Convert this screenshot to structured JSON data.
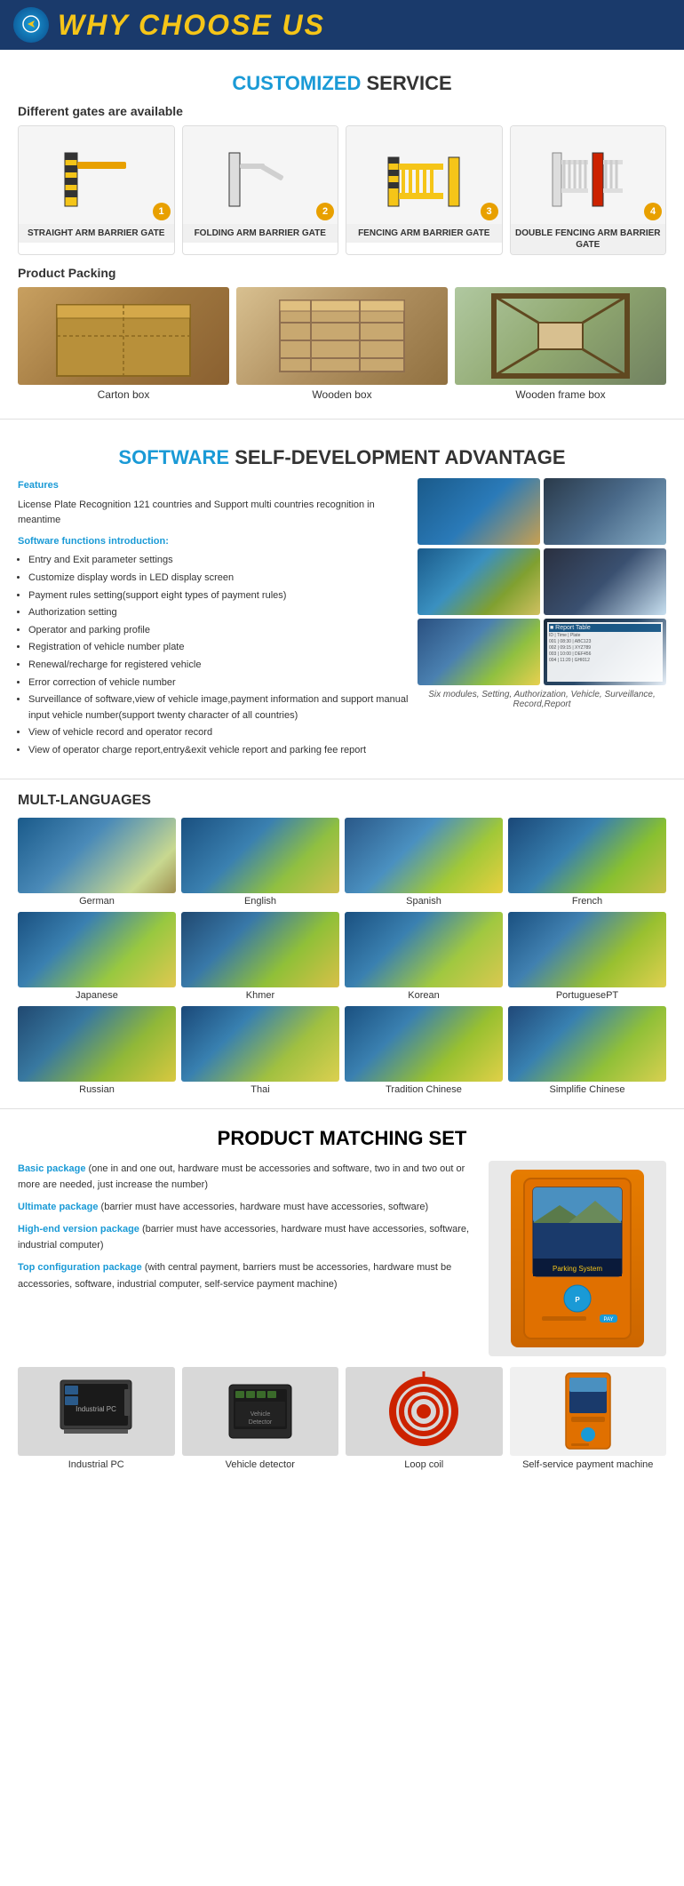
{
  "header": {
    "title_why": "WHY CHOOSE US",
    "title_highlight": "WHY",
    "title_rest": " CHOOSE US"
  },
  "customized": {
    "section_title_highlight": "CUSTOMIZED",
    "section_title_rest": " SERVICE",
    "gates_header": "Different gates are available",
    "gates": [
      {
        "number": "1",
        "label": "STRAIGHT ARM BARRIER GATE"
      },
      {
        "number": "2",
        "label": "FOLDING ARM BARRIER GATE"
      },
      {
        "number": "3",
        "label": "FENCING ARM BARRIER GATE"
      },
      {
        "number": "4",
        "label": "DOUBLE FENCING ARM BARRIER GATE"
      }
    ]
  },
  "packing": {
    "title": "Product Packing",
    "items": [
      {
        "label": "Carton box"
      },
      {
        "label": "Wooden box"
      },
      {
        "label": "Wooden frame box"
      }
    ]
  },
  "software": {
    "section_title_highlight": "SOFTWARE",
    "section_title_rest": " SELF-DEVELOPMENT ADVANTAGE",
    "features_label": "Features",
    "features_text": "License Plate Recognition 121 countries and Support multi countries recognition in meantime",
    "intro_label": "Software functions introduction:",
    "functions": [
      "Entry and Exit parameter settings",
      "Customize display words in LED display screen",
      "Payment rules setting(support eight types of payment rules)",
      "Authorization setting",
      "Operator and parking profile",
      "Registration of vehicle number plate",
      "Renewal/recharge for registered vehicle",
      "Error correction of vehicle number",
      "Surveillance of software,view of vehicle image,payment information and support manual input vehicle number(support twenty character of all countries)",
      "View of vehicle record and operator record",
      "View of operator charge report,entry&exit vehicle report and parking fee report"
    ],
    "screenshot_caption": "Six modules, Setting, Authorization, Vehicle, Surveillance, Record,Report"
  },
  "languages": {
    "title": "MULT-LANGUAGES",
    "items": [
      {
        "label": "German"
      },
      {
        "label": "English"
      },
      {
        "label": "Spanish"
      },
      {
        "label": "French"
      },
      {
        "label": "Japanese"
      },
      {
        "label": "Khmer"
      },
      {
        "label": "Korean"
      },
      {
        "label": "PortuguesePT"
      },
      {
        "label": "Russian"
      },
      {
        "label": "Thai"
      },
      {
        "label": "Tradition Chinese"
      },
      {
        "label": "Simplifie Chinese"
      }
    ]
  },
  "matching": {
    "section_title_highlight": "PRODUCT",
    "section_title_rest": " MATCHING SET",
    "packages": [
      {
        "title": "Basic package",
        "desc": "(one in and one out, hardware must be accessories and software, two in and two out or more are needed, just increase the number)"
      },
      {
        "title": "Ultimate package",
        "desc": "(barrier must have accessories, hardware must have accessories, software)"
      },
      {
        "title": "High-end version package",
        "desc": "(barrier must have accessories, hardware must have accessories, software, industrial computer)"
      },
      {
        "title": "Top configuration package",
        "desc": "(with central payment, barriers must be accessories, hardware must be accessories, software, industrial computer, self-service payment machine)"
      }
    ],
    "products": [
      {
        "label": "Industrial PC"
      },
      {
        "label": "Vehicle detector"
      },
      {
        "label": "Loop coil"
      },
      {
        "label": "Self-service payment machine"
      }
    ]
  }
}
